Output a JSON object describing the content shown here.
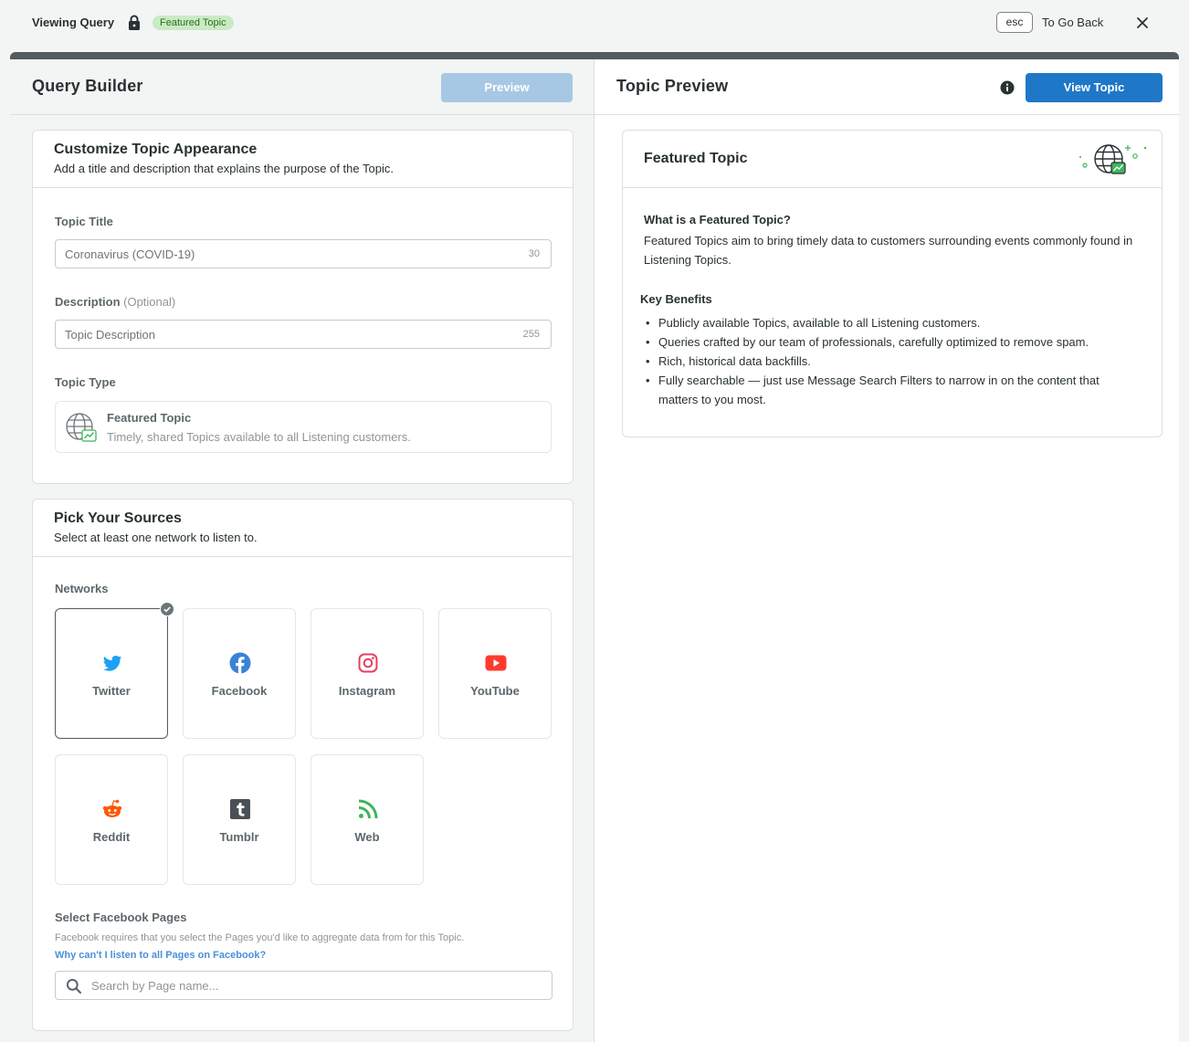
{
  "topbar": {
    "title": "Viewing Query",
    "badge": "Featured Topic",
    "esc_key": "esc",
    "back_label": "To Go Back"
  },
  "builder": {
    "title": "Query Builder",
    "preview_button": "Preview",
    "appearance": {
      "title": "Customize Topic Appearance",
      "subtitle": "Add a title and description that explains the purpose of the Topic.",
      "topic_title_label": "Topic Title",
      "topic_title_value": "Coronavirus (COVID-19)",
      "topic_title_count": "30",
      "description_label": "Description",
      "description_optional": "(Optional)",
      "description_placeholder": "Topic Description",
      "description_count": "255",
      "topic_type_label": "Topic Type",
      "topic_type_name": "Featured Topic",
      "topic_type_desc": "Timely, shared Topics available to all Listening customers."
    },
    "sources": {
      "title": "Pick Your Sources",
      "subtitle": "Select at least one network to listen to.",
      "networks_label": "Networks",
      "networks": [
        {
          "label": "Twitter",
          "icon": "twitter-icon",
          "selected": true,
          "color": "#1da1f2"
        },
        {
          "label": "Facebook",
          "icon": "facebook-icon",
          "selected": false,
          "color": "#3b82d6"
        },
        {
          "label": "Instagram",
          "icon": "instagram-icon",
          "selected": false,
          "color": "#e4405f"
        },
        {
          "label": "YouTube",
          "icon": "youtube-icon",
          "selected": false,
          "color": "#ff3b30"
        },
        {
          "label": "Reddit",
          "icon": "reddit-icon",
          "selected": false,
          "color": "#ff5700"
        },
        {
          "label": "Tumblr",
          "icon": "tumblr-icon",
          "selected": false,
          "color": "#4a5156"
        },
        {
          "label": "Web",
          "icon": "rss-icon",
          "selected": false,
          "color": "#3fb55a"
        }
      ],
      "fb_pages_title": "Select Facebook Pages",
      "fb_pages_help": "Facebook requires that you select the Pages you'd like to aggregate data from for this Topic.",
      "fb_pages_link": "Why can't I listen to all Pages on Facebook?",
      "search_placeholder": "Search by Page name..."
    }
  },
  "preview": {
    "title": "Topic Preview",
    "view_button": "View Topic",
    "card": {
      "title": "Featured Topic",
      "question": "What is a Featured Topic?",
      "description": "Featured Topics aim to bring timely data to customers surrounding events commonly found in Listening Topics.",
      "benefits_title": "Key Benefits",
      "benefits": [
        "Publicly available Topics, available to all Listening customers.",
        "Queries crafted by our team of professionals, carefully optimized to remove spam.",
        "Rich, historical data backfills.",
        "Fully searchable — just use Message Search Filters to narrow in on the content that matters to you most."
      ]
    }
  },
  "colors": {
    "primary": "#1f77c7",
    "primary_disabled": "#a7c8e4",
    "badge_bg": "#c8ebc3",
    "frame_border": "#525b5f"
  }
}
